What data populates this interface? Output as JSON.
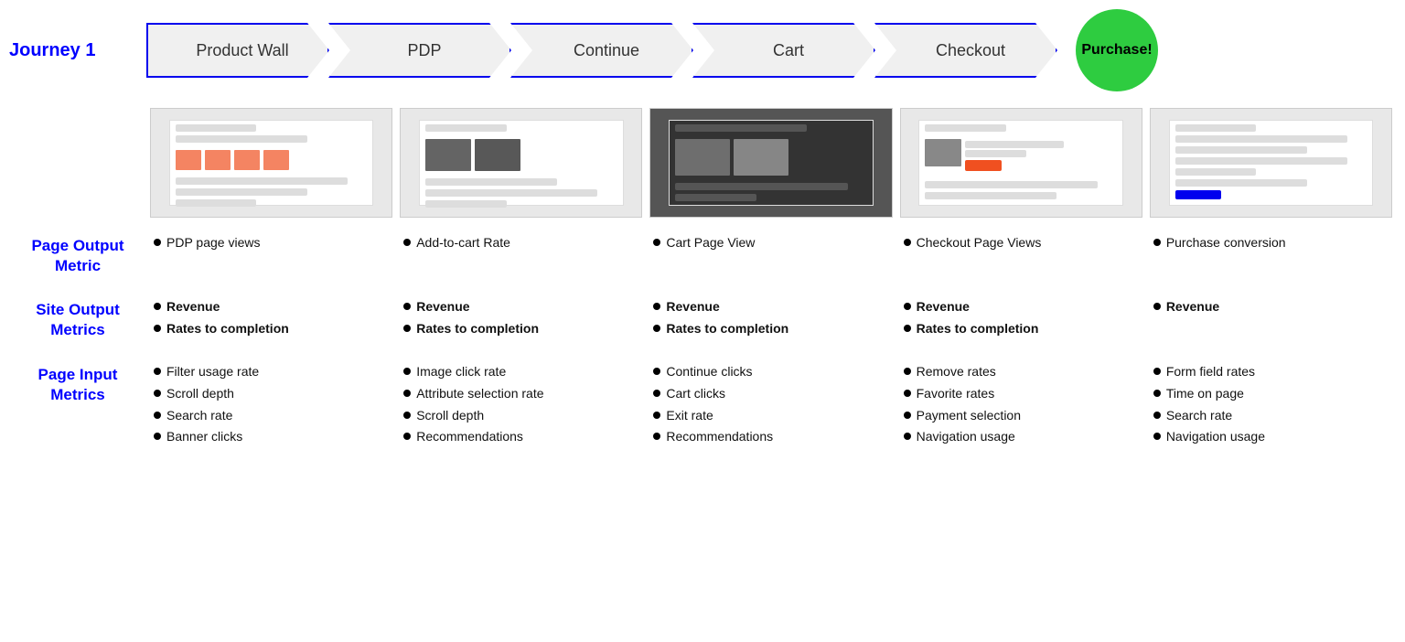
{
  "journey": {
    "label": "Journey 1",
    "steps": [
      {
        "name": "Product Wall"
      },
      {
        "name": "PDP"
      },
      {
        "name": "Continue"
      },
      {
        "name": "Cart"
      },
      {
        "name": "Checkout"
      }
    ],
    "purchase_label": "Purchase!"
  },
  "screenshots": [
    {
      "id": "product-wall-ss",
      "dark": false
    },
    {
      "id": "pdp-ss",
      "dark": false
    },
    {
      "id": "continue-ss",
      "dark": true
    },
    {
      "id": "cart-ss",
      "dark": false
    },
    {
      "id": "checkout-ss",
      "dark": false
    }
  ],
  "page_output": {
    "label": "Page Output Metric",
    "columns": [
      {
        "items": [
          {
            "text": "PDP page views",
            "bold": false
          }
        ]
      },
      {
        "items": [
          {
            "text": "Add-to-cart Rate",
            "bold": false
          }
        ]
      },
      {
        "items": [
          {
            "text": "Cart Page View",
            "bold": false
          }
        ]
      },
      {
        "items": [
          {
            "text": "Checkout Page Views",
            "bold": false
          }
        ]
      },
      {
        "items": [
          {
            "text": "Purchase conversion",
            "bold": false
          }
        ]
      }
    ]
  },
  "site_output": {
    "label": "Site Output Metrics",
    "columns": [
      {
        "items": [
          {
            "text": "Revenue",
            "bold": true
          },
          {
            "text": "Rates to completion",
            "bold": true
          }
        ]
      },
      {
        "items": [
          {
            "text": "Revenue",
            "bold": true
          },
          {
            "text": "Rates to completion",
            "bold": true
          }
        ]
      },
      {
        "items": [
          {
            "text": "Revenue",
            "bold": true
          },
          {
            "text": "Rates to completion",
            "bold": true
          }
        ]
      },
      {
        "items": [
          {
            "text": "Revenue",
            "bold": true
          },
          {
            "text": "Rates to completion",
            "bold": true
          }
        ]
      },
      {
        "items": [
          {
            "text": "Revenue",
            "bold": true
          }
        ]
      }
    ]
  },
  "page_input": {
    "label": "Page Input Metrics",
    "columns": [
      {
        "items": [
          {
            "text": "Filter usage rate",
            "bold": false
          },
          {
            "text": "Scroll depth",
            "bold": false
          },
          {
            "text": "Search rate",
            "bold": false
          },
          {
            "text": "Banner clicks",
            "bold": false
          }
        ]
      },
      {
        "items": [
          {
            "text": "Image click rate",
            "bold": false
          },
          {
            "text": "Attribute selection rate",
            "bold": false
          },
          {
            "text": "Scroll depth",
            "bold": false
          },
          {
            "text": "Recommendations",
            "bold": false
          }
        ]
      },
      {
        "items": [
          {
            "text": "Continue clicks",
            "bold": false
          },
          {
            "text": "Cart clicks",
            "bold": false
          },
          {
            "text": "Exit rate",
            "bold": false
          },
          {
            "text": "Recommendations",
            "bold": false
          }
        ]
      },
      {
        "items": [
          {
            "text": "Remove rates",
            "bold": false
          },
          {
            "text": "Favorite rates",
            "bold": false
          },
          {
            "text": "Payment selection",
            "bold": false
          },
          {
            "text": "Navigation usage",
            "bold": false
          }
        ]
      },
      {
        "items": [
          {
            "text": "Form field rates",
            "bold": false
          },
          {
            "text": "Time on page",
            "bold": false
          },
          {
            "text": "Search rate",
            "bold": false
          },
          {
            "text": "Navigation usage",
            "bold": false
          }
        ]
      }
    ]
  }
}
